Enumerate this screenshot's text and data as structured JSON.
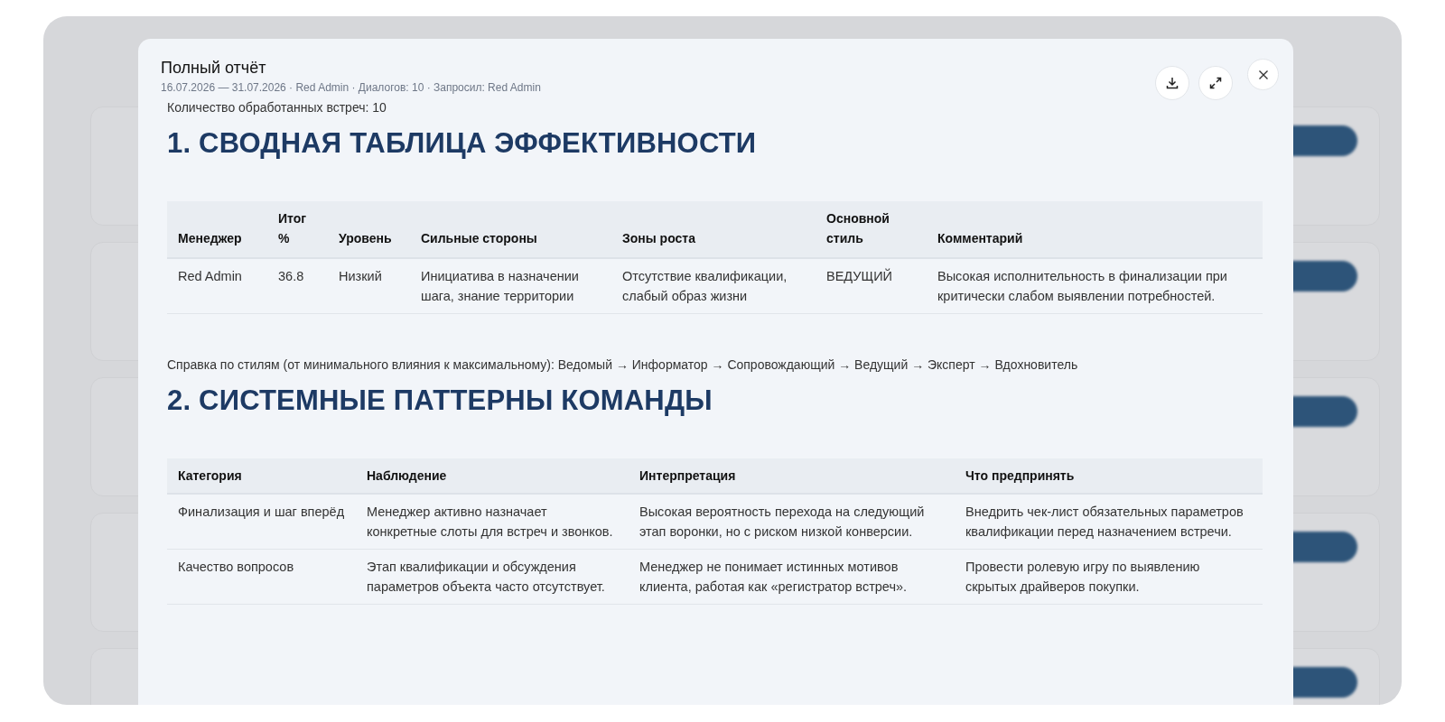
{
  "modal": {
    "title": "Полный отчёт",
    "subtitle": "16.07.2026 — 31.07.2026 · Red Admin · Диалогов: 10 · Запросил: Red Admin"
  },
  "report": {
    "intro": "Количество обработанных встреч: 10",
    "section_1": {
      "heading": "1. СВОДНАЯ ТАБЛИЦА ЭФФЕКТИВНОСТИ",
      "columns": [
        "Менеджер",
        "Итог %",
        "Уровень",
        "Сильные стороны",
        "Зоны роста",
        "Основной стиль",
        "Комментарий"
      ],
      "rows": [
        [
          "Red Admin",
          "36.8",
          "Низкий",
          "Инициатива в назначении шага, знание территории",
          "Отсутствие квалификации, слабый образ жизни",
          "ВЕДУЩИЙ",
          "Высокая исполнительность в финализации при критически слабом выявлении потребностей."
        ]
      ]
    },
    "style_note": "Справка по стилям (от минимального влияния к максимальному): Ведомый → Информатор → Сопровождающий → Ведущий → Эксперт → Вдохновитель",
    "section_2": {
      "heading": "2. СИСТЕМНЫЕ ПАТТЕРНЫ КОМАНДЫ",
      "columns": [
        "Категория",
        "Наблюдение",
        "Интерпретация",
        "Что предпринять"
      ],
      "rows": [
        [
          "Финализация и шаг вперёд",
          "Менеджер активно назначает конкретные слоты для встреч и звонков.",
          "Высокая вероятность перехода на следующий этап воронки, но с риском низкой конверсии.",
          "Внедрить чек-лист обязательных параметров квалификации перед назначением встречи."
        ],
        [
          "Качество вопросов",
          "Этап квалификации и обсуждения параметров объекта часто отсутствует.",
          "Менеджер не понимает истинных мотивов клиента, работая как «регистратор встреч».",
          "Провести ролевую игру по выявлению скрытых драйверов покупки."
        ]
      ]
    }
  }
}
